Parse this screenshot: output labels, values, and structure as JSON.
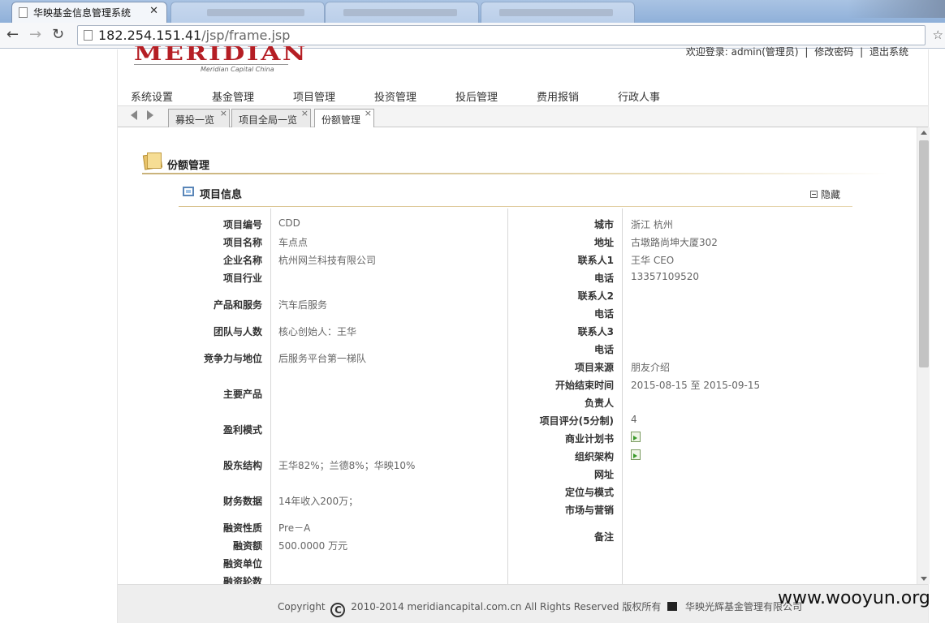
{
  "browser": {
    "active_tab_title": "华映基金信息管理系统",
    "url_host": "182.254.151.41",
    "url_path": "/jsp/frame.jsp"
  },
  "header": {
    "logo_text": "MERIDIAN",
    "logo_subtitle": "Meridian Capital China",
    "welcome": "欢迎登录: admin(管理员)",
    "sep": "|",
    "change_password": "修改密码",
    "logout": "退出系统"
  },
  "nav": {
    "items": [
      "系统设置",
      "基金管理",
      "项目管理",
      "投资管理",
      "投后管理",
      "费用报销",
      "行政人事"
    ]
  },
  "page_tabs": [
    {
      "label": "募投一览",
      "close": "×"
    },
    {
      "label": "项目全局一览",
      "close": "×"
    },
    {
      "label": "份额管理",
      "close": "×"
    }
  ],
  "section": {
    "title": "份额管理",
    "subtitle": "项目信息",
    "hide_label": "隐藏"
  },
  "left_fields": [
    {
      "label": "项目编号",
      "value": "CDD"
    },
    {
      "label": "项目名称",
      "value": "车点点"
    },
    {
      "label": "企业名称",
      "value": "杭州网兰科技有限公司"
    },
    {
      "label": "项目行业",
      "value": ""
    },
    {
      "label": "产品和服务",
      "value": "汽车后服务"
    },
    {
      "label": "团队与人数",
      "value": "核心创始人：王华"
    },
    {
      "label": "竞争力与地位",
      "value": "后服务平台第一梯队"
    },
    {
      "label": "主要产品",
      "value": ""
    },
    {
      "label": "盈利模式",
      "value": ""
    },
    {
      "label": "股东结构",
      "value": "王华82%；兰德8%；华映10%"
    },
    {
      "label": "财务数据",
      "value": "14年收入200万；"
    },
    {
      "label": "融资性质",
      "value": "Pre－A"
    },
    {
      "label": "融资额",
      "value": "500.0000 万元"
    },
    {
      "label": "融资单位",
      "value": ""
    },
    {
      "label": "融资轮数",
      "value": ""
    }
  ],
  "right_fields": [
    {
      "label": "城市",
      "value": "浙江 杭州"
    },
    {
      "label": "地址",
      "value": "古墩路尚坤大厦302"
    },
    {
      "label": "联系人1",
      "value": "王华 CEO"
    },
    {
      "label": "电话",
      "value": "13357109520"
    },
    {
      "label": "联系人2",
      "value": ""
    },
    {
      "label": "电话",
      "value": ""
    },
    {
      "label": "联系人3",
      "value": ""
    },
    {
      "label": "电话",
      "value": ""
    },
    {
      "label": "项目来源",
      "value": "朋友介绍"
    },
    {
      "label": "开始结束时间",
      "value": "2015-08-15 至 2015-09-15"
    },
    {
      "label": "负责人",
      "value": ""
    },
    {
      "label": "项目评分(5分制)",
      "value": "4"
    },
    {
      "label": "商业计划书",
      "value": ""
    },
    {
      "label": "组织架构",
      "value": ""
    },
    {
      "label": "网址",
      "value": ""
    },
    {
      "label": "定位与模式",
      "value": ""
    },
    {
      "label": "市场与营销",
      "value": ""
    },
    {
      "label": "备注",
      "value": ""
    }
  ],
  "footer": {
    "copyright_word": "Copyright",
    "copyright_text": "2010-2014 meridiancapital.com.cn All Rights Reserved 版权所有",
    "company": "华映光辉基金管理有限公司"
  },
  "watermark": "www.wooyun.org"
}
